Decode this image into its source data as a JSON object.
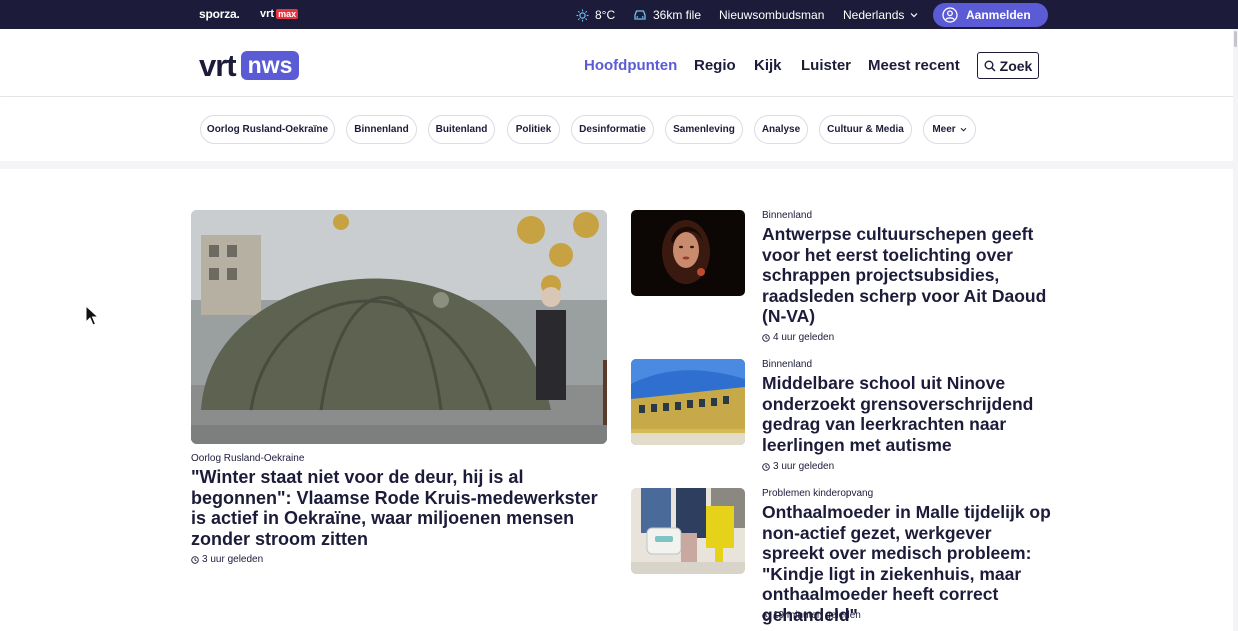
{
  "topbar": {
    "sporza": "sporza.",
    "vrt": "vrt",
    "max": "max",
    "weather": "8°C",
    "traffic": "36km file",
    "ombudsman": "Nieuwsombudsman",
    "language": "Nederlands",
    "login": "Aanmelden"
  },
  "header": {
    "logo_vrt": "vrt",
    "logo_nws": "nws",
    "nav": [
      "Hoofdpunten",
      "Regio",
      "Kijk",
      "Luister",
      "Meest recent"
    ],
    "search": "Zoek"
  },
  "tags": [
    "Oorlog Rusland-Oekraïne",
    "Binnenland",
    "Buitenland",
    "Politiek",
    "Desinformatie",
    "Samenleving",
    "Analyse",
    "Cultuur & Media",
    "Meer"
  ],
  "hero": {
    "category": "Oorlog Rusland-Oekraine",
    "title": "\"Winter staat niet voor de deur, hij is al begonnen\": Vlaamse Rode Kruis-medewerkster is actief in Oekraïne, waar miljoenen mensen zonder stroom zitten",
    "time": "3 uur geleden"
  },
  "articles": [
    {
      "category": "Binnenland",
      "title": "Antwerpse cultuurschepen geeft voor het eerst toelichting over schrappen projectsubsidies, raadsleden scherp voor Ait Daoud (N-VA)",
      "time": "4 uur geleden"
    },
    {
      "category": "Binnenland",
      "title": "Middelbare school uit Ninove onderzoekt grensoverschrijdend gedrag van leerkrachten naar leerlingen met autisme",
      "time": "3 uur geleden"
    },
    {
      "category": "Problemen kinderopvang",
      "title": "Onthaalmoeder in Malle tijdelijk op non-actief gezet, werkgever spreekt over medisch probleem: \"Kindje ligt in ziekenhuis, maar onthaalmoeder heeft correct gehandeld\"",
      "time": "19 minuten geleden"
    }
  ],
  "colors": {
    "brand_dark": "#1c1c3a",
    "accent": "#5b5bd6",
    "max_red": "#e8343f"
  }
}
